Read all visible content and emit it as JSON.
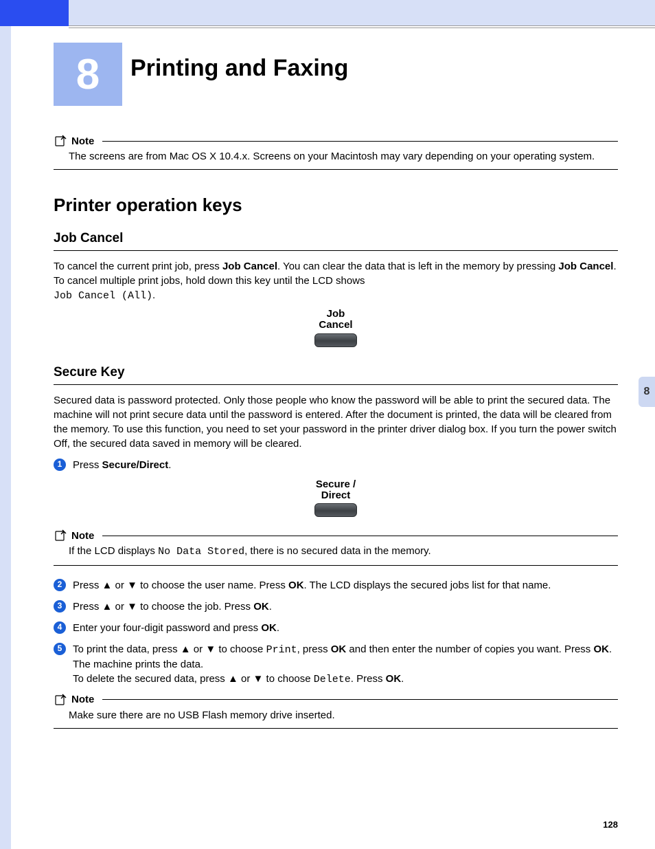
{
  "chapter": {
    "number": "8",
    "title": "Printing and Faxing"
  },
  "side_tab": "8",
  "page_number": "128",
  "note1": {
    "label": "Note",
    "text": "The screens are from Mac OS X 10.4.x. Screens on your Macintosh may vary depending on your operating system."
  },
  "section1": {
    "heading": "Printer operation keys",
    "sub1": {
      "heading": "Job Cancel",
      "p_pre": "To cancel the current print job, press ",
      "p_bold1": "Job Cancel",
      "p_mid1": ". You can clear the data that is left in the memory by pressing ",
      "p_bold2": "Job Cancel",
      "p_mid2": ". To cancel multiple print jobs, hold down this key until the LCD shows ",
      "p_mono": "Job Cancel (All)",
      "p_post": ".",
      "btn_label1": "Job",
      "btn_label2": "Cancel"
    },
    "sub2": {
      "heading": "Secure Key",
      "p": "Secured data is password protected. Only those people who know the password will be able to print the secured data. The machine will not print secure data until the password is entered. After the document is printed, the data will be cleared from the memory. To use this function, you need to set your password in the printer driver dialog box. If you turn the power switch Off, the secured data saved in memory will be cleared.",
      "step1_pre": "Press ",
      "step1_bold": "Secure/Direct",
      "step1_post": ".",
      "btn_label1": "Secure /",
      "btn_label2": "Direct",
      "note2_label": "Note",
      "note2_pre": "If the LCD displays ",
      "note2_mono": "No Data Stored",
      "note2_post": ", there is no secured data in the memory.",
      "step2_a": "Press ",
      "step2_b": " or ",
      "step2_c": " to choose the user name. Press ",
      "step2_ok": "OK",
      "step2_d": ". The LCD displays the secured jobs list for that name.",
      "step3_a": "Press ",
      "step3_b": " or ",
      "step3_c": " to choose the job. Press ",
      "step3_ok": "OK",
      "step3_d": ".",
      "step4_a": "Enter your four-digit password and press ",
      "step4_ok": "OK",
      "step4_b": ".",
      "step5_a": "To print the data, press ",
      "step5_b": " or ",
      "step5_c": " to choose ",
      "step5_mono1": "Print",
      "step5_d": ", press ",
      "step5_ok1": "OK",
      "step5_e": " and then enter the number of copies you want. Press ",
      "step5_ok2": "OK",
      "step5_f": ".",
      "step5_line2": "The machine prints the data.",
      "step5_g": "To delete the secured data, press ",
      "step5_h": " or ",
      "step5_i": " to choose ",
      "step5_mono2": "Delete",
      "step5_j": ". Press ",
      "step5_ok3": "OK",
      "step5_k": ".",
      "note3_label": "Note",
      "note3_text": "Make sure there are no USB Flash memory drive inserted."
    }
  },
  "glyphs": {
    "up": "▲",
    "down": "▼"
  }
}
